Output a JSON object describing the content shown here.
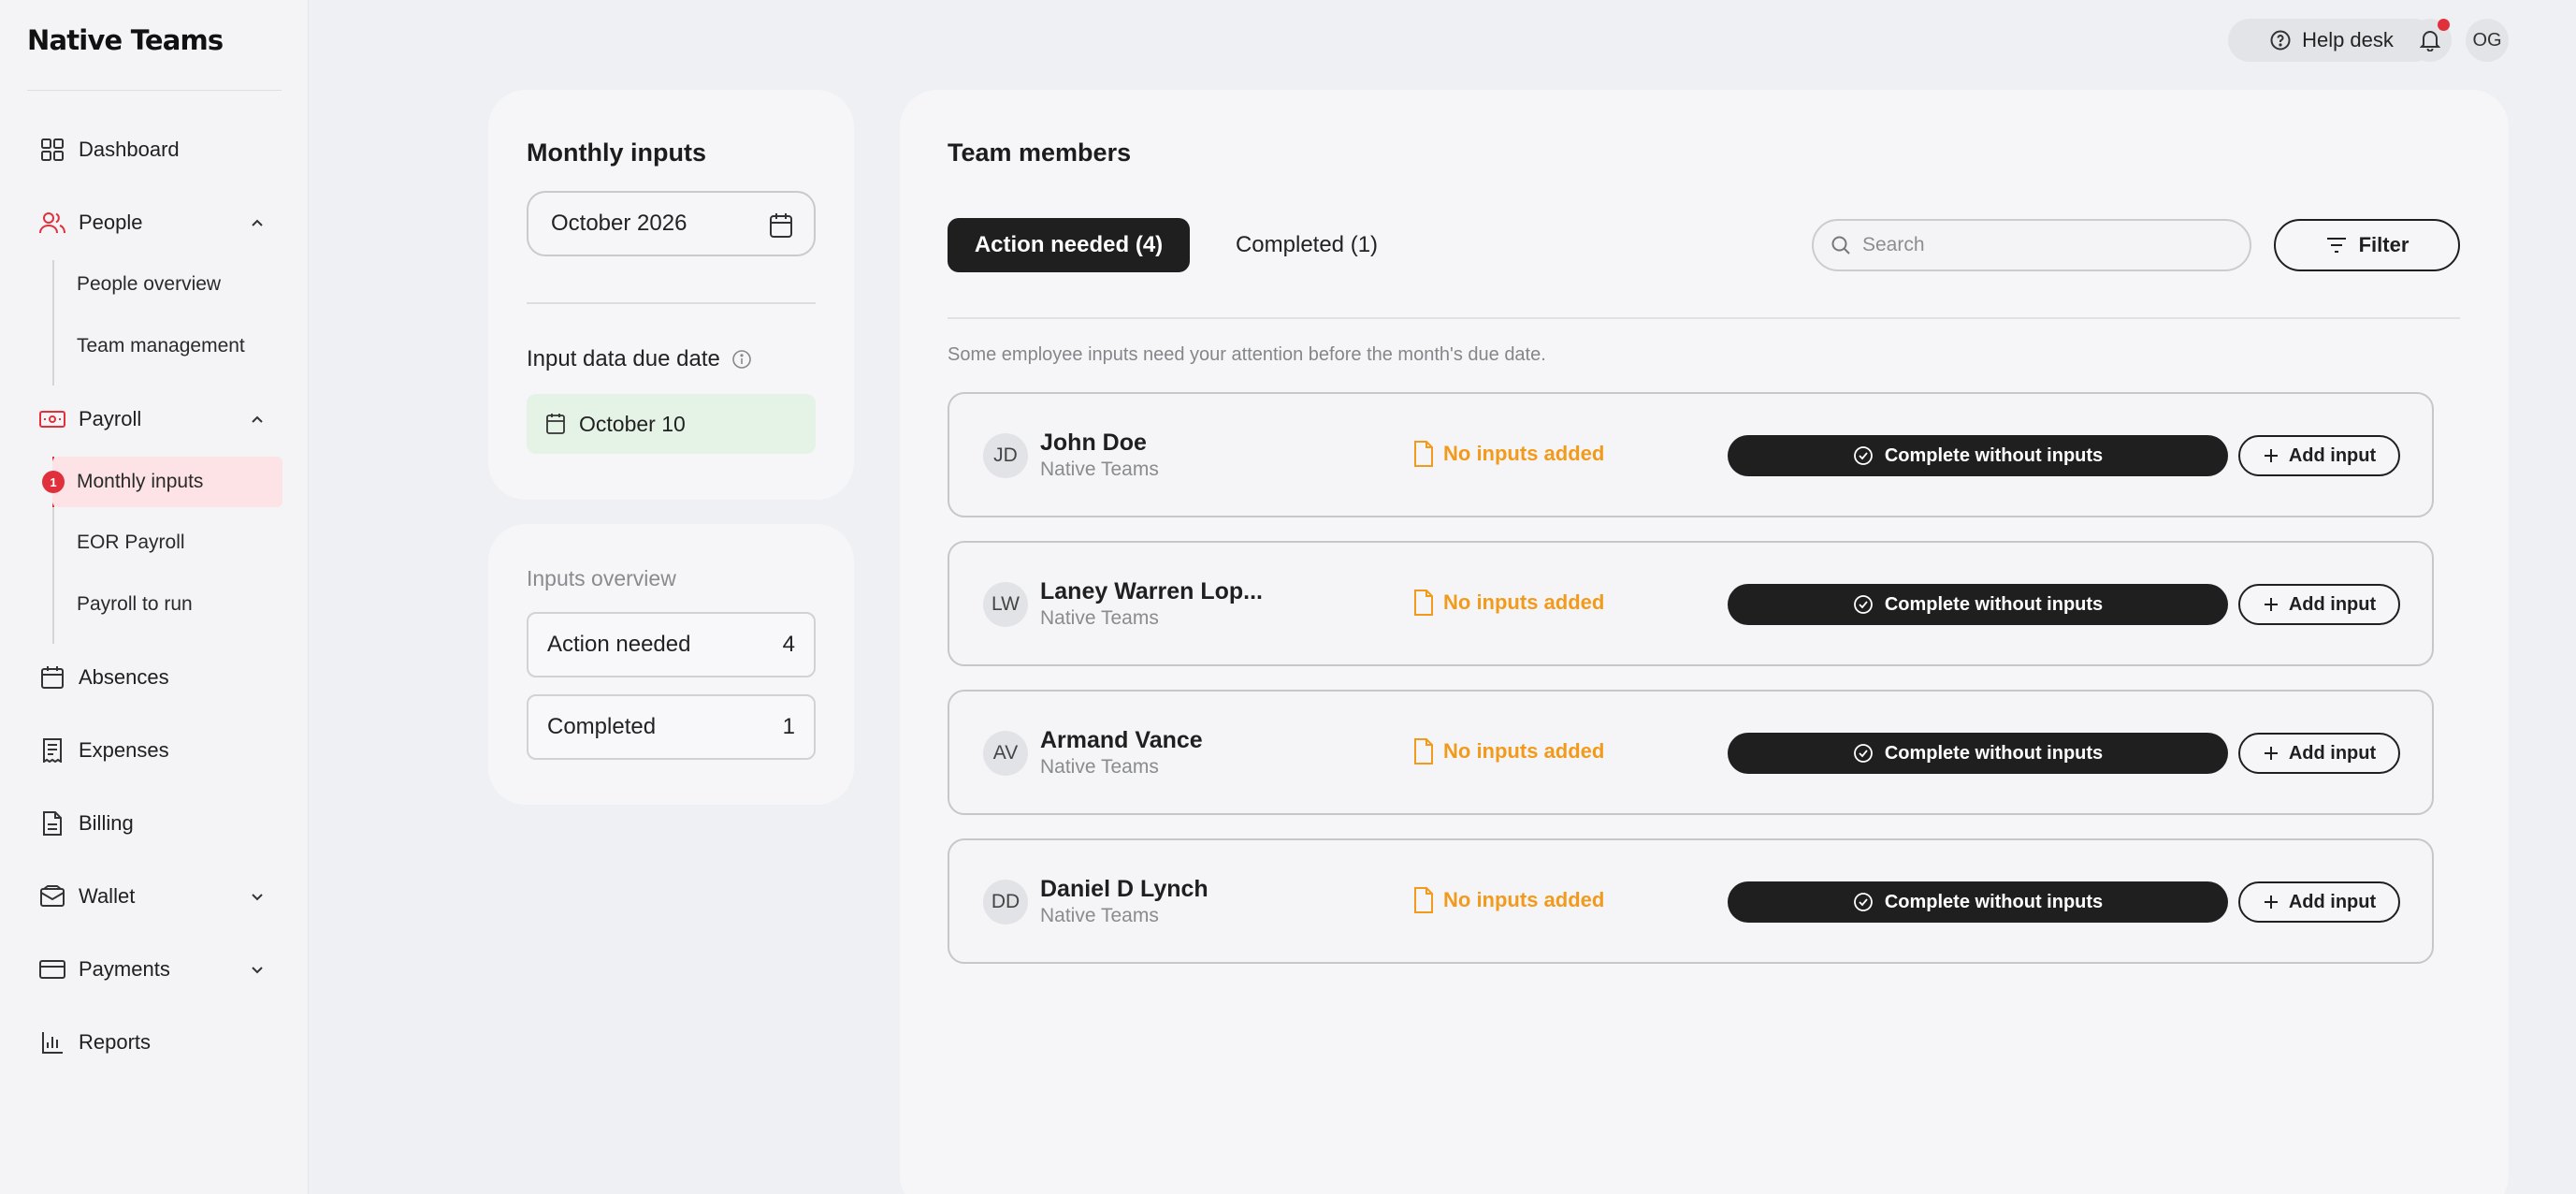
{
  "brand": {
    "logo": "Native Teams"
  },
  "sidebar": {
    "dashboard": "Dashboard",
    "people": "People",
    "people_overview": "People overview",
    "team_management": "Team management",
    "payroll": "Payroll",
    "monthly_inputs": "Monthly inputs",
    "monthly_inputs_badge": "1",
    "eor_payroll": "EOR Payroll",
    "payroll_to_run": "Payroll to run",
    "absences": "Absences",
    "expenses": "Expenses",
    "billing": "Billing",
    "wallet": "Wallet",
    "payments": "Payments",
    "reports": "Reports"
  },
  "topbar": {
    "help_desk": "Help desk",
    "user_initials": "OG"
  },
  "monthly_inputs_card": {
    "title": "Monthly inputs",
    "selected_month": "October 2026",
    "due_label": "Input data due date",
    "due_date": "October 10"
  },
  "inputs_overview": {
    "title": "Inputs overview",
    "rows": [
      {
        "label": "Action needed",
        "count": "4"
      },
      {
        "label": "Completed",
        "count": "1"
      }
    ]
  },
  "team_members": {
    "title": "Team members",
    "tab_action": "Action needed (4)",
    "tab_completed": "Completed (1)",
    "search_placeholder": "Search",
    "filter_label": "Filter",
    "hint": "Some employee inputs need your attention before the month's due date.",
    "complete_label": "Complete without inputs",
    "add_label": "Add input",
    "members": [
      {
        "initials": "JD",
        "name": "John Doe",
        "company": "Native Teams",
        "status": "No inputs added"
      },
      {
        "initials": "LW",
        "name": "Laney Warren Lop...",
        "company": "Native Teams",
        "status": "No inputs added"
      },
      {
        "initials": "AV",
        "name": "Armand Vance",
        "company": "Native Teams",
        "status": "No inputs added"
      },
      {
        "initials": "DD",
        "name": "Daniel D Lynch",
        "company": "Native Teams",
        "status": "No inputs added"
      }
    ]
  },
  "colors": {
    "accent_red": "#e0303c",
    "warning_orange": "#f29a1c",
    "dark": "#1f1f1f",
    "due_green": "#e5f2e6"
  }
}
